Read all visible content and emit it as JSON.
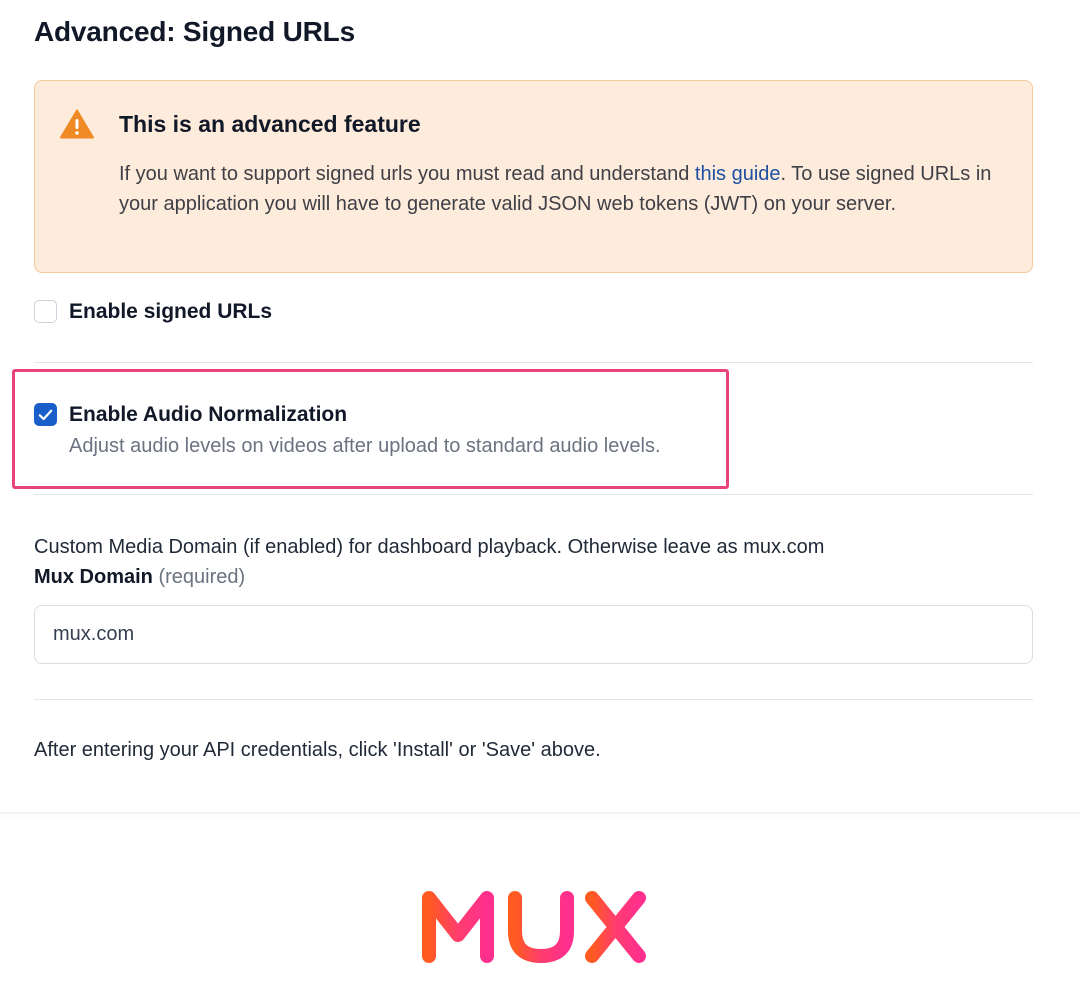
{
  "section": {
    "title": "Advanced: Signed URLs"
  },
  "warning": {
    "icon": "warning-triangle-icon",
    "title": "This is an advanced feature",
    "body_before_link": "If you want to support signed urls you must read and understand ",
    "link_text": "this guide",
    "body_after_link": ". To use signed URLs in your application you will have to generate valid JSON web tokens (JWT) on your server.",
    "colors": {
      "background": "#fdebdc",
      "border": "#f5c99a",
      "icon": "#f08a24",
      "link": "#1d4fa3"
    }
  },
  "signed_urls": {
    "label": "Enable signed URLs",
    "checked": false
  },
  "audio_normalization": {
    "label": "Enable Audio Normalization",
    "description": "Adjust audio levels on videos after upload to standard audio levels.",
    "checked": true,
    "highlight_color": "#e8437a"
  },
  "domain": {
    "help_text": "Custom Media Domain (if enabled) for dashboard playback. Otherwise leave as mux.com",
    "label": "Mux Domain",
    "required_text": "(required)",
    "value": "mux.com"
  },
  "footer": {
    "note": "After entering your API credentials, click 'Install' or 'Save' above."
  },
  "brand": {
    "logo_text": "MUX",
    "colors": [
      "#ff5a1f",
      "#ff3d6e",
      "#ff2f8e"
    ]
  }
}
